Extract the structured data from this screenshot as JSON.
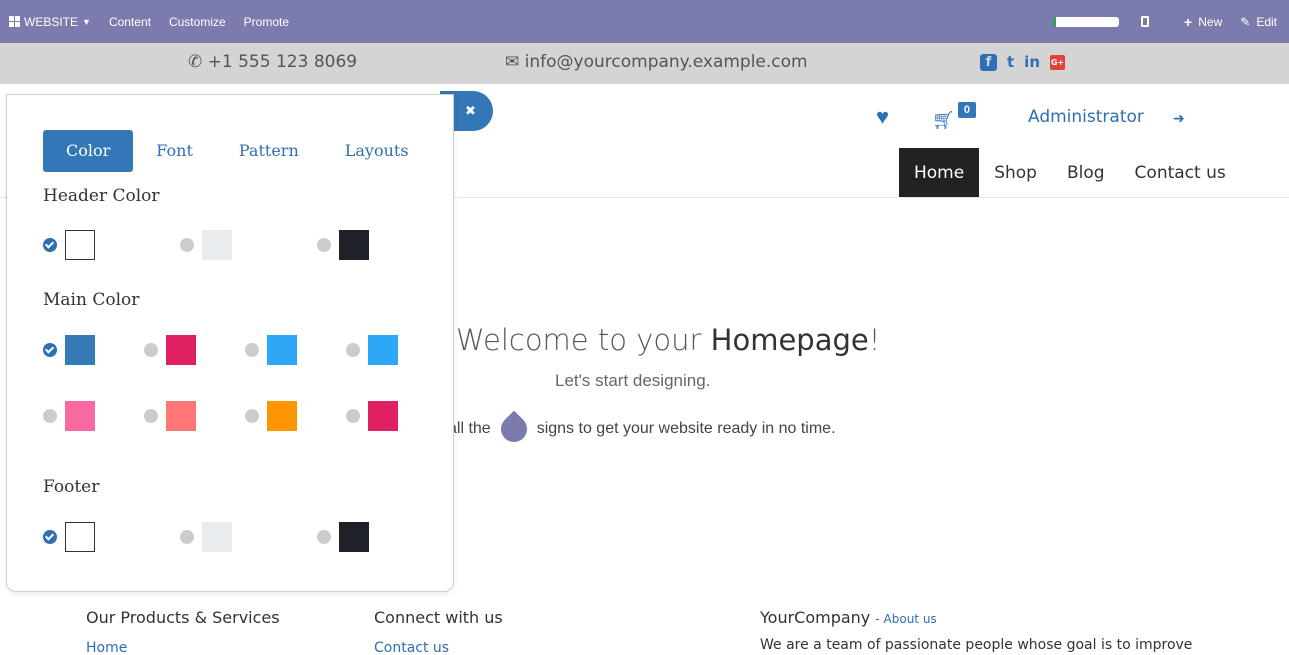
{
  "adminbar": {
    "website_label": "WEBSITE",
    "menu": [
      "Content",
      "Customize",
      "Promote"
    ],
    "new_label": "New",
    "edit_label": "Edit"
  },
  "contact": {
    "phone": "+1 555 123 8069",
    "email": "info@yourcompany.example.com",
    "social": [
      "f",
      "t",
      "in",
      "G+"
    ]
  },
  "header": {
    "cart_count": "0",
    "user_name": "Administrator",
    "nav": [
      "Home",
      "Shop",
      "Blog",
      "Contact us"
    ],
    "active_nav": "Home"
  },
  "hero": {
    "title_pre": "Welcome to your ",
    "title_bold": "Homepage",
    "title_post": "!",
    "subtitle": "Let's start designing.",
    "tip_pre": "all the",
    "tip_post": "signs to get your website ready in no time."
  },
  "panel": {
    "tabs": [
      "Color",
      "Font",
      "Pattern",
      "Layouts"
    ],
    "header_color_label": "Header Color",
    "main_color_label": "Main Color",
    "footer_label": "Footer",
    "header_colors": [
      "#ffffff",
      "#e9ecef",
      "#1f2128"
    ],
    "main_colors_row1": [
      "#337ab7",
      "#e02062",
      "#2ca8f7",
      "#2ca8f7"
    ],
    "main_colors_row2": [
      "#f868a1",
      "#ff7676",
      "#ff9500",
      "#e02062"
    ],
    "footer_colors": [
      "#ffffff",
      "#e9ecef",
      "#1f2128"
    ],
    "selected": "first"
  },
  "footer": {
    "col1_title": "Our Products & Services",
    "col1_link": "Home",
    "col2_title": "Connect with us",
    "col2_link": "Contact us",
    "col3_title": "YourCompany",
    "col3_about": "- About us",
    "col3_text": "We are a team of passionate people whose goal is to improve"
  }
}
